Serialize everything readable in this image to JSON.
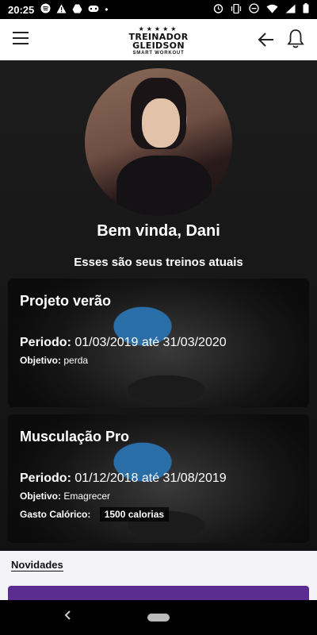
{
  "status_bar": {
    "time": "20:25",
    "left_icons": [
      "spotify-icon",
      "warning-icon",
      "drive-icon",
      "gamepad-icon",
      "dot-icon"
    ],
    "right_icons": [
      "alarm-icon",
      "vibrate-icon",
      "minus-circle-icon",
      "wifi-icon",
      "signal-icon",
      "battery-icon"
    ]
  },
  "app_bar": {
    "logo_stars": "★★★★★",
    "logo_line1": "TREINADOR",
    "logo_line2": "GLEIDSON",
    "logo_line3": "SMART WORKOUT"
  },
  "profile": {
    "greeting": "Bem vinda, Dani"
  },
  "section_title": "Esses são seus treinos atuais",
  "cards": [
    {
      "title": "Projeto verão",
      "period_label": "Periodo:",
      "period_value": "01/03/2019 até 31/03/2020",
      "objective_label": "Objetivo:",
      "objective_value": "perda"
    },
    {
      "title": "Musculação Pro",
      "period_label": "Periodo:",
      "period_value": "01/12/2018 até 31/08/2019",
      "objective_label": "Objetivo:",
      "objective_value": "Emagrecer",
      "calories_label": "Gasto Calórico:",
      "calories_value": "1500 calorias"
    }
  ],
  "news": {
    "label": "Novidades"
  },
  "colors": {
    "accent": "#5c2d91",
    "app_bar": "#ffffff",
    "background": "#161616"
  }
}
